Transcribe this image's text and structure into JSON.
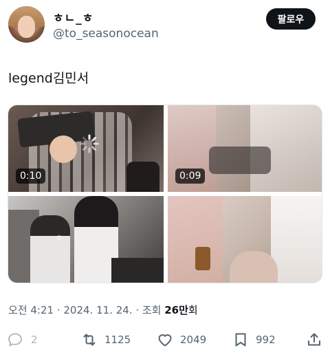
{
  "author": {
    "display_name": "ㅎㄴ_ㅎ",
    "handle": "@to_seasonocean"
  },
  "follow_label": "팔로우",
  "tweet_text": "legend김민서",
  "media": [
    {
      "duration": "0:10"
    },
    {
      "duration": "0:09"
    },
    {
      "duration": ""
    },
    {
      "duration": ""
    }
  ],
  "meta": {
    "time_date": "오전 4:21 · 2024. 11. 24. · 조회 ",
    "views_number": "26만",
    "views_unit": "회"
  },
  "actions": {
    "replies": "2",
    "retweets": "1125",
    "likes": "2049",
    "bookmarks": "992"
  },
  "colors": {
    "text_primary": "#0f1419",
    "text_secondary": "#536471",
    "button_bg": "#0f1419"
  }
}
